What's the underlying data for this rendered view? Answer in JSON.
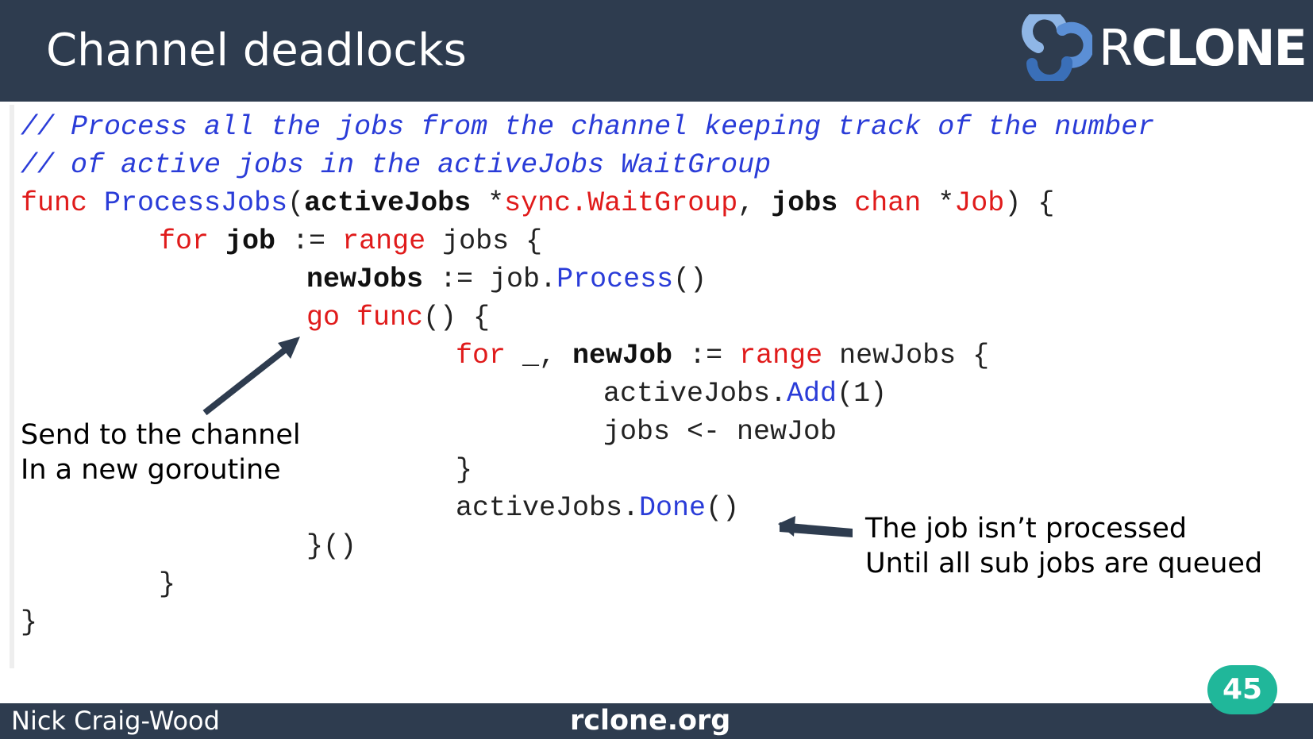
{
  "slide": {
    "title": "Channel deadlocks",
    "page_number": "45"
  },
  "logo": {
    "word_thin": "R",
    "word_bold": "CLONE",
    "icon": "rclone-logo-icon",
    "colors": {
      "dark_blue": "#3a6fb8",
      "light_blue": "#8fb6e6",
      "mid_blue": "#5b8fd6"
    }
  },
  "code": {
    "line1": {
      "comment": "// Process all the jobs from the channel keeping track of the number"
    },
    "line2": {
      "comment": "// of active jobs in the activeJobs WaitGroup"
    },
    "line3": {
      "kw_func": "func",
      "fn_name": "ProcessJobs",
      "p_open": "(",
      "id_activeJobs": "activeJobs",
      "p_star": " *",
      "kw_sync": "sync.WaitGroup",
      "p_comma": ", ",
      "id_jobs": "jobs",
      "p_sp": " ",
      "kw_chan": "chan",
      "p_star2": " *",
      "kw_job": "Job",
      "p_close": ") {"
    },
    "line4": {
      "kw_for": "for",
      "p_sp": " ",
      "id_job": "job",
      "p_assign": " := ",
      "kw_range": "range",
      "p_rest": " jobs {"
    },
    "line5": {
      "id_newJobs": "newJobs",
      "p_assign": " := job.",
      "fn_process": "Process",
      "p_call": "()"
    },
    "line6": {
      "kw_go": "go",
      "p_sp": " ",
      "kw_func": "func",
      "p_rest": "() {"
    },
    "line7": {
      "kw_for": "for",
      "p_us": " _, ",
      "id_newJob": "newJob",
      "p_assign": " := ",
      "kw_range": "range",
      "p_rest": " newJobs {"
    },
    "line8": {
      "p_obj": "activeJobs.",
      "fn_add": "Add",
      "p_args": "(1)"
    },
    "line9": {
      "text": "jobs <- newJob"
    },
    "line10": {
      "text": "}"
    },
    "line11": {
      "p_obj": "activeJobs.",
      "fn_done": "Done",
      "p_call": "()"
    },
    "line12": {
      "text": "}()"
    },
    "line13": {
      "text": "}"
    },
    "line14": {
      "text": "}"
    }
  },
  "annotations": {
    "left": {
      "line1": "Send to the channel",
      "line2": "In a new goroutine"
    },
    "right": {
      "line1": "The job isn’t processed",
      "line2": "Until all sub jobs are queued"
    }
  },
  "footer": {
    "author": "Nick Craig-Wood",
    "site": "rclone.org"
  },
  "colors": {
    "header_bg": "#2e3c4f",
    "badge_bg": "#20b79a",
    "keyword": "#e01b1b",
    "comment": "#2a3cd8",
    "arrow": "#2e3c4f"
  }
}
